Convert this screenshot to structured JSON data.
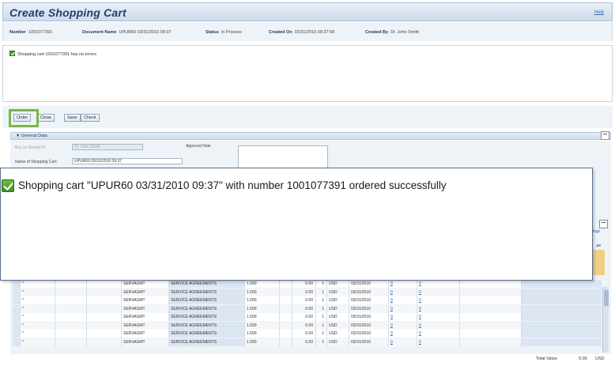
{
  "header": {
    "title": "Create Shopping Cart",
    "help": "Help"
  },
  "info": {
    "number_label": "Number",
    "number_value": "1001077391",
    "docname_label": "Document Name",
    "docname_value": "UPUR60 03/31/2010 09:37",
    "status_label": "Status",
    "status_value": "In Process",
    "created_on_label": "Created On",
    "created_on_value": "03/31/2010 09:37:58",
    "created_by_label": "Created By",
    "created_by_value": "Dr. John Smith"
  },
  "message": {
    "text": "Shopping cart 1001077391 has no errors"
  },
  "toolbar": {
    "order": "Order",
    "close": "Close",
    "save": "Save",
    "check": "Check"
  },
  "general": {
    "title": "General Data",
    "behalf_label": "Buy on Behalf Of:",
    "behalf_value": "Dr. John Smith",
    "name_label": "Name of Shopping Cart:",
    "name_value": "UPUR60 03/31/2010 09:37",
    "approval_label": "Approval Note"
  },
  "table": {
    "side_header": "ttings",
    "side_header2": "pe",
    "rows": [
      {
        "mark": "*",
        "product": "SERVAGMT",
        "category": "SERVICE AGREEMENTS",
        "qty": "1.000",
        "price": "0.00",
        "per": "1",
        "cur": "USD",
        "date": "03/31/2010",
        "l1": "0",
        "l2": "0"
      },
      {
        "mark": "*",
        "product": "SERVAGMT",
        "category": "SERVICE AGREEMENTS",
        "qty": "1.000",
        "price": "0.00",
        "per": "1",
        "cur": "USD",
        "date": "03/31/2010",
        "l1": "0",
        "l2": "0"
      },
      {
        "mark": "*",
        "product": "SERVAGMT",
        "category": "SERVICE AGREEMENTS",
        "qty": "1.000",
        "price": "0.00",
        "per": "1",
        "cur": "USD",
        "date": "03/31/2010",
        "l1": "0",
        "l2": "0"
      },
      {
        "mark": "*",
        "product": "SERVAGMT",
        "category": "SERVICE AGREEMENTS",
        "qty": "1.000",
        "price": "0.00",
        "per": "1",
        "cur": "USD",
        "date": "03/31/2010",
        "l1": "0",
        "l2": "0"
      },
      {
        "mark": "*",
        "product": "SERVAGMT",
        "category": "SERVICE AGREEMENTS",
        "qty": "1.000",
        "price": "0.00",
        "per": "1",
        "cur": "USD",
        "date": "03/31/2010",
        "l1": "0",
        "l2": "0"
      },
      {
        "mark": "*",
        "product": "SERVAGMT",
        "category": "SERVICE AGREEMENTS",
        "qty": "1.000",
        "price": "0.00",
        "per": "1",
        "cur": "USD",
        "date": "03/31/2010",
        "l1": "0",
        "l2": "0"
      },
      {
        "mark": "*",
        "product": "SERVAGMT",
        "category": "SERVICE AGREEMENTS",
        "qty": "1.000",
        "price": "0.00",
        "per": "1",
        "cur": "USD",
        "date": "03/31/2010",
        "l1": "0",
        "l2": "0"
      },
      {
        "mark": "*",
        "product": "SERVAGMT",
        "category": "SERVICE AGREEMENTS",
        "qty": "1.000",
        "price": "0.00",
        "per": "1",
        "cur": "USD",
        "date": "03/31/2010",
        "l1": "0",
        "l2": "0"
      }
    ],
    "total_label": "Total Value",
    "total_value": "0.00",
    "total_currency": "USD"
  },
  "popup": {
    "text": "Shopping cart \"UPUR60 03/31/2010 09:37\" with number 1001077391 ordered successfully"
  },
  "colors": {
    "highlight": "#7ab648",
    "success": "#4f9e3a",
    "title": "#243e6a"
  },
  "icons": {
    "success": "check-icon",
    "collapse": "minimize-icon"
  }
}
